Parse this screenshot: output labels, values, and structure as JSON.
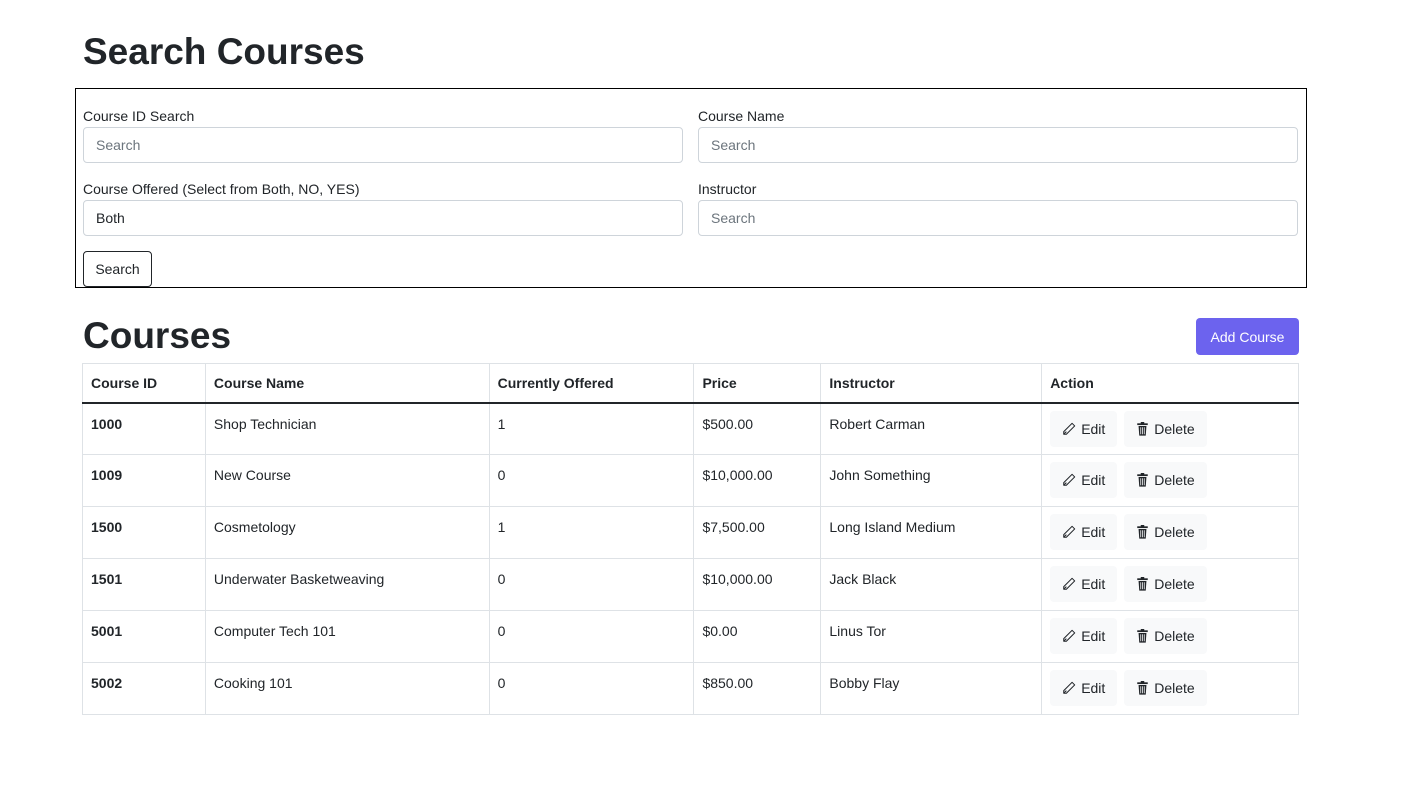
{
  "page": {
    "title": "Search Courses"
  },
  "search_form": {
    "course_id": {
      "label": "Course ID Search",
      "placeholder": "Search",
      "value": ""
    },
    "course_name": {
      "label": "Course Name",
      "placeholder": "Search",
      "value": ""
    },
    "offered": {
      "label": "Course Offered (Select from Both, NO, YES)",
      "placeholder": "",
      "value": "Both"
    },
    "instructor": {
      "label": "Instructor",
      "placeholder": "Search",
      "value": ""
    },
    "search_button": "Search"
  },
  "courses": {
    "title": "Courses",
    "add_button": "Add Course",
    "columns": [
      "Course ID",
      "Course Name",
      "Currently Offered",
      "Price",
      "Instructor",
      "Action"
    ],
    "rows": [
      {
        "id": "1000",
        "name": "Shop Technician",
        "offered": "1",
        "price": "$500.00",
        "instructor": "Robert Carman"
      },
      {
        "id": "1009",
        "name": "New Course",
        "offered": "0",
        "price": "$10,000.00",
        "instructor": "John Something"
      },
      {
        "id": "1500",
        "name": "Cosmetology",
        "offered": "1",
        "price": "$7,500.00",
        "instructor": "Long Island Medium"
      },
      {
        "id": "1501",
        "name": "Underwater Basketweaving",
        "offered": "0",
        "price": "$10,000.00",
        "instructor": "Jack Black"
      },
      {
        "id": "5001",
        "name": "Computer Tech 101",
        "offered": "0",
        "price": "$0.00",
        "instructor": "Linus Tor"
      },
      {
        "id": "5002",
        "name": "Cooking 101",
        "offered": "0",
        "price": "$850.00",
        "instructor": "Bobby Flay"
      }
    ],
    "edit_label": "Edit",
    "delete_label": "Delete"
  },
  "colors": {
    "accent": "#6c63ee",
    "text": "#212529",
    "muted": "#6c757d"
  }
}
